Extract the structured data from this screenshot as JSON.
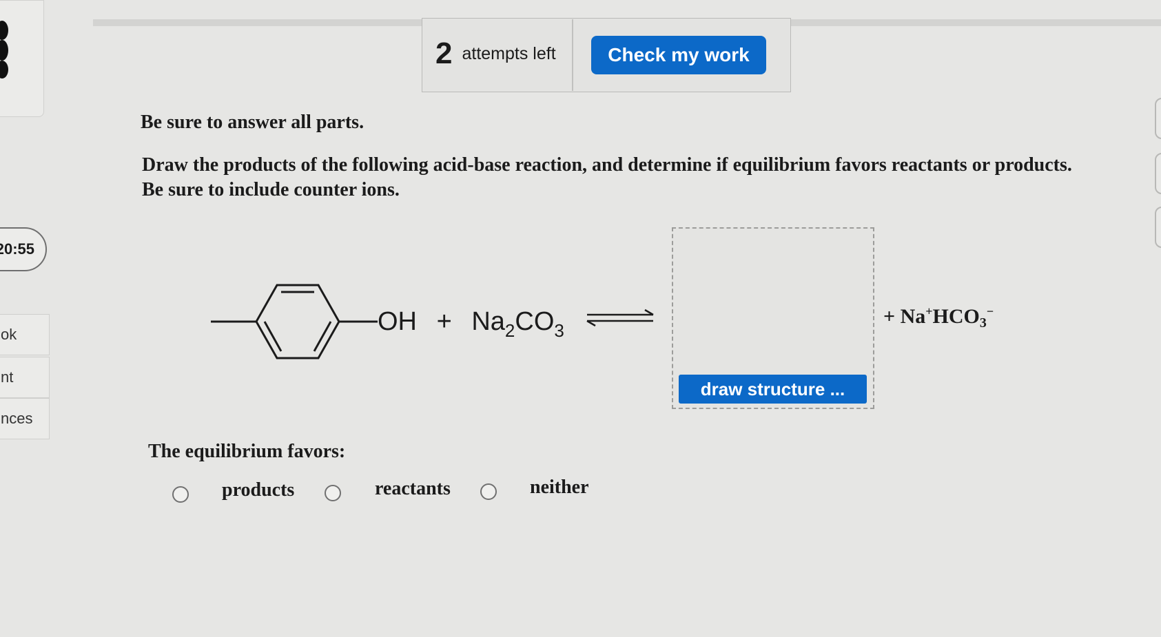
{
  "header": {
    "attempts_count": "2",
    "attempts_label": "attempts left",
    "check_button": "Check my work"
  },
  "sidebar": {
    "timer": "20:55",
    "tabs": [
      "ok",
      "nt",
      "nces"
    ]
  },
  "instructions": "Be sure to answer all parts.",
  "question": "Draw the products of the following acid-base reaction, and determine if equilibrium favors reactants or products. Be sure to include counter ions.",
  "reaction": {
    "oh_label": "OH",
    "plus": "+",
    "reagent_main": "Na",
    "reagent_sub1": "2",
    "reagent_co": "CO",
    "reagent_sub2": "3",
    "draw_button": "draw structure ...",
    "product_plus": "+ Na",
    "product_plus_charge": "+",
    "product_hco": "HCO",
    "product_sub": "3",
    "product_minus": "−"
  },
  "equilibrium": {
    "label": "The equilibrium favors:",
    "options": [
      "products",
      "reactants",
      "neither"
    ]
  },
  "icons": [
    "radio-empty-icon",
    "equilibrium-arrows-icon"
  ],
  "colors": {
    "accent": "#0c69c8",
    "background": "#e6e6e4"
  }
}
